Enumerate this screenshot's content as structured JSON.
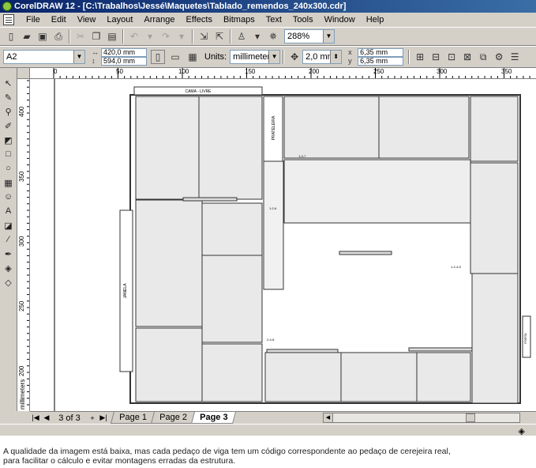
{
  "window": {
    "title": "CorelDRAW 12 - [C:\\Trabalhos\\Jessé\\Maquetes\\Tablado_remendos_240x300.cdr]"
  },
  "menu": [
    "File",
    "Edit",
    "View",
    "Layout",
    "Arrange",
    "Effects",
    "Bitmaps",
    "Text",
    "Tools",
    "Window",
    "Help"
  ],
  "standard_toolbar": {
    "zoom_value": "288%"
  },
  "property_bar": {
    "paper_size": "A2",
    "width": "420,0 mm",
    "height": "594,0 mm",
    "units_label": "Units:",
    "units_value": "millimeters",
    "nudge": "2,0 mm",
    "dup_x": "6,35 mm",
    "dup_y": "6,35 mm"
  },
  "rulers": {
    "horizontal": [
      "0",
      "50",
      "100",
      "150",
      "200",
      "250",
      "300",
      "350"
    ],
    "vertical": [
      "400",
      "350",
      "300",
      "250",
      "200"
    ],
    "unit": "millimeters"
  },
  "drawing_labels": {
    "cama": "CAMA - LIVRE",
    "prateleira": "PRATELEIRA",
    "janela": "JANELA",
    "porta": "PORTA",
    "p1": "1-3-7",
    "p2": "1-2-6",
    "p3": "2-4-8",
    "p4": "1-2-4-5"
  },
  "page_nav": {
    "counter": "3 of 3",
    "tabs": [
      "Page 1",
      "Page 2",
      "Page 3"
    ],
    "active_tab": "Page 3"
  },
  "caption": {
    "line1": "A qualidade da imagem está baixa, mas cada pedaço de viga tem um código correspondente ao pedaço de cerejeira real,",
    "line2": "para facilitar o cálculo e evitar montagens erradas da estrutura."
  }
}
